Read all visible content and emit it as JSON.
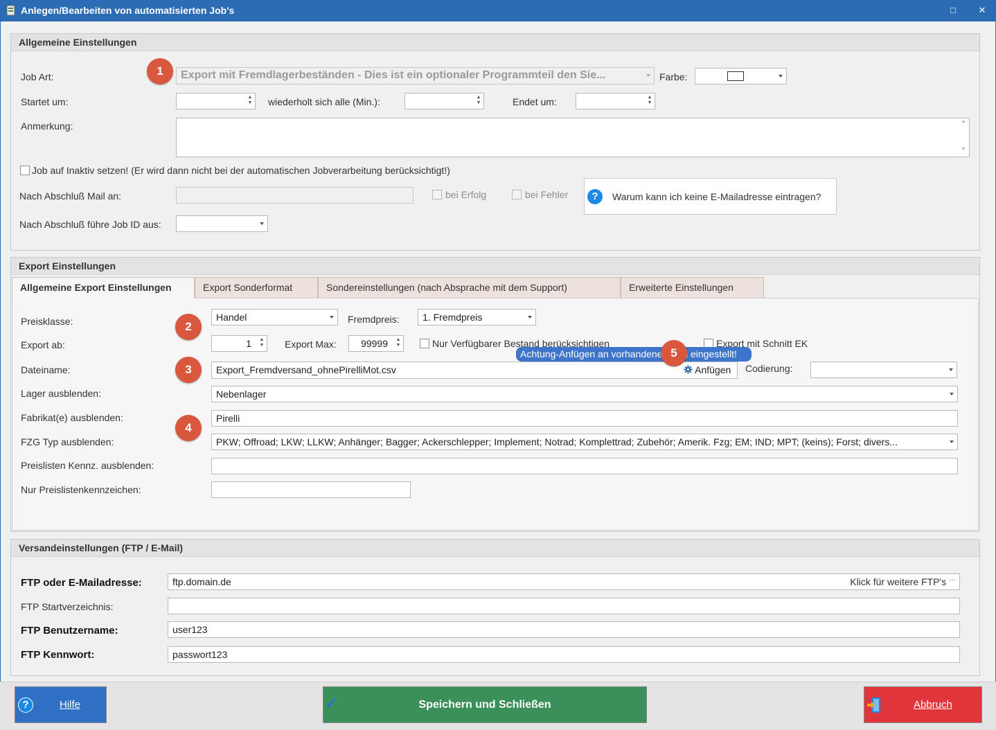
{
  "window": {
    "title": "Anlegen/Bearbeiten von automatisierten Job's",
    "maximize_glyph": "□",
    "close_glyph": "✕"
  },
  "badges": [
    "1",
    "2",
    "3",
    "4",
    "5"
  ],
  "general": {
    "header": "Allgemeine Einstellungen",
    "job_art_label": "Job Art:",
    "job_art_value": "Export mit Fremdlagerbeständen - Dies ist ein optionaler Programmteil den Sie...",
    "farbe_label": "Farbe:",
    "startet_label": "Startet um:",
    "startet_value": "",
    "wiederholt_label": "wiederholt sich alle (Min.):",
    "wiederholt_value": "",
    "endet_label": "Endet um:",
    "endet_value": "",
    "anmerkung_label": "Anmerkung:",
    "anmerkung_value": "",
    "inaktiv_label": "Job auf Inaktiv setzen! (Er wird dann nicht bei der automatischen Jobverarbeitung berücksichtigt!)",
    "mail_label": "Nach Abschluß Mail an:",
    "mail_value": "",
    "bei_erfolg_label": "bei Erfolg",
    "bei_fehler_label": "bei Fehler",
    "why_mail_text": "Warum kann ich keine E-Mailadresse eintragen?",
    "job_id_label": "Nach Abschluß führe Job ID aus:",
    "job_id_value": ""
  },
  "export": {
    "header": "Export Einstellungen",
    "tabs": [
      {
        "label": "Allgemeine Export Einstellungen"
      },
      {
        "label": "Export Sonderformat"
      },
      {
        "label": "Sondereinstellungen (nach Absprache mit dem Support)"
      },
      {
        "label": "Erweiterte Einstellungen"
      }
    ],
    "preisklasse_label": "Preisklasse:",
    "preisklasse_value": "Handel",
    "fremdpreis_label": "Fremdpreis:",
    "fremdpreis_value": "1. Fremdpreis",
    "export_ab_label": "Export ab:",
    "export_ab_value": "1",
    "export_max_label": "Export Max:",
    "export_max_value": "99999",
    "nur_verfuegbar_label": "Nur Verfügbarer Bestand berücksichtigen",
    "schnitt_ek_label": "Export mit Schnitt EK",
    "warning_tooltip": "Achtung-Anfügen an vorhandene Datei eingestellt!",
    "dateiname_label": "Dateiname:",
    "dateiname_value": "Export_Fremdversand_ohnePirelliMot.csv",
    "anfuegen_label": "Anfügen",
    "codierung_label": "Codierung:",
    "codierung_value": "",
    "lager_label": "Lager ausblenden:",
    "lager_value": "Nebenlager",
    "fabrikat_label": "Fabrikat(e) ausblenden:",
    "fabrikat_value": "Pirelli",
    "fzg_label": "FZG Typ  ausblenden:",
    "fzg_value": "PKW; Offroad; LKW; LLKW; Anhänger; Bagger; Ackerschlepper; Implement; Notrad; Komplettrad; Zubehör; Amerik. Fzg; EM; IND; MPT; (keins); Forst; divers...",
    "preislisten_label": "Preislisten Kennz. ausblenden:",
    "preislisten_value": "",
    "nur_preislisten_label": "Nur Preislistenkennzeichen:",
    "nur_preislisten_value": ""
  },
  "versand": {
    "header": "Versandeinstellungen (FTP / E-Mail)",
    "ftp_label": "FTP oder E-Mailadresse:",
    "ftp_value": "ftp.domain.de",
    "ftp_more": "Klick für weitere FTP's",
    "start_dir_label": "FTP Startverzeichnis:",
    "start_dir_value": "",
    "user_label": "FTP Benutzername:",
    "user_value": "user123",
    "pass_label": "FTP Kennwort:",
    "pass_value": "passwort123"
  },
  "buttons": {
    "help": "Hilfe",
    "save": "Speichern und Schließen",
    "cancel": "Abbruch"
  },
  "colors": {
    "titlebar": "#2b6cb5",
    "badge": "#d9573d",
    "help_button": "#2f70c4",
    "save_button": "#3a9058",
    "cancel_button": "#e0353a",
    "tooltip": "#3e74c9"
  },
  "icons": {
    "help": "question-circle-icon",
    "save": "checkmark-icon",
    "cancel": "exit-door-icon",
    "anfuegen": "gear-icon"
  }
}
